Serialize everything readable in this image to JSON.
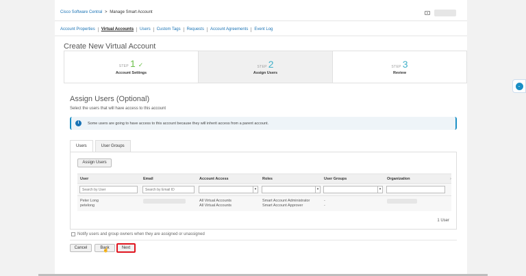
{
  "breadcrumb": {
    "root": "Cisco Software Central",
    "separator": ">",
    "current": "Manage Smart Account"
  },
  "nav": {
    "items": [
      "Account Properties",
      "Virtual Accounts",
      "Users",
      "Custom Tags",
      "Requests",
      "Account Agreements",
      "Event Log"
    ],
    "active": "Virtual Accounts"
  },
  "page_title": "Create New Virtual Account",
  "steps": [
    {
      "word": "STEP",
      "number": "1",
      "label": "Account Settings",
      "state": "done"
    },
    {
      "word": "STEP",
      "number": "2",
      "label": "Assign Users",
      "state": "current"
    },
    {
      "word": "STEP",
      "number": "3",
      "label": "Review",
      "state": "pending"
    }
  ],
  "section": {
    "title": "Assign Users (Optional)",
    "subtitle": "Select the users that will have access to this account"
  },
  "alert": {
    "icon": "info-icon",
    "text": "Some users are going to have access to this account because they will inherit access from a parent account."
  },
  "tabs": [
    "Users",
    "User Groups"
  ],
  "active_tab": "Users",
  "assign_users_label": "Assign Users",
  "table": {
    "columns": [
      "User",
      "Email",
      "Account Access",
      "Roles",
      "User Groups",
      "Organization"
    ],
    "filters": {
      "user_placeholder": "Search by User",
      "email_placeholder": "Search by Email ID"
    },
    "rows": [
      {
        "user_name": "Peter Long",
        "user_id": "petelong",
        "access_1": "All Virtual Accounts",
        "access_2": "All Virtual Accounts",
        "role_1": "Smart Account Administrator",
        "role_2": "Smart Account Approver",
        "group_1": "-",
        "group_2": "-"
      }
    ],
    "count_label": "1 User"
  },
  "notify_label": "Notify users and group owners when they are assigned or unassigned",
  "buttons": {
    "cancel": "Cancel",
    "back": "Back",
    "next": "Next"
  },
  "colors": {
    "link": "#1a73b5",
    "step_done": "#6cc04a",
    "step_number": "#3fb0c9",
    "highlight_border": "#e0141e"
  }
}
